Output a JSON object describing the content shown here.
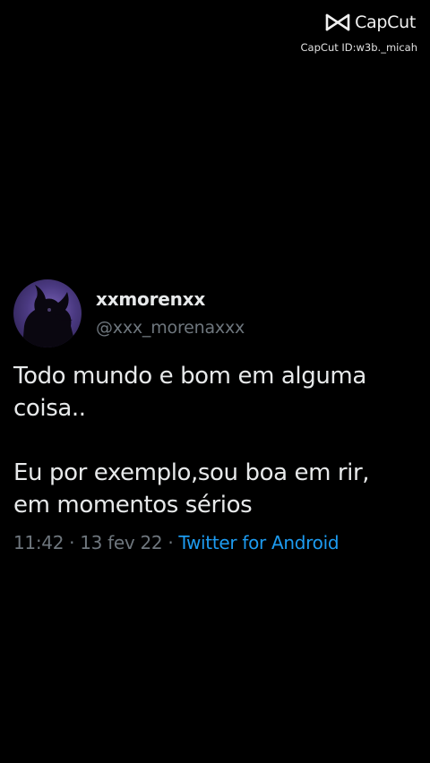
{
  "watermark": {
    "brand": "CapCut",
    "id_text": "CapCut ID:w3b._micah",
    "icon": "capcut-logo-icon"
  },
  "tweet": {
    "display_name": "xxmorenxx",
    "handle": "@xxx_morenaxxx",
    "avatar_icon": "avatar-silhouette",
    "text_paragraph_1": "Todo mundo e bom em alguma coisa..",
    "text_paragraph_2": "Eu por exemplo,sou boa em rir, em momentos sérios",
    "time": "11:42",
    "separator": "·",
    "date": "13 fev 22",
    "source": "Twitter for Android"
  },
  "colors": {
    "background": "#000000",
    "text": "#e7e9ea",
    "muted": "#6e767d",
    "link": "#1d9bf0",
    "avatar": "#6a55a8"
  }
}
